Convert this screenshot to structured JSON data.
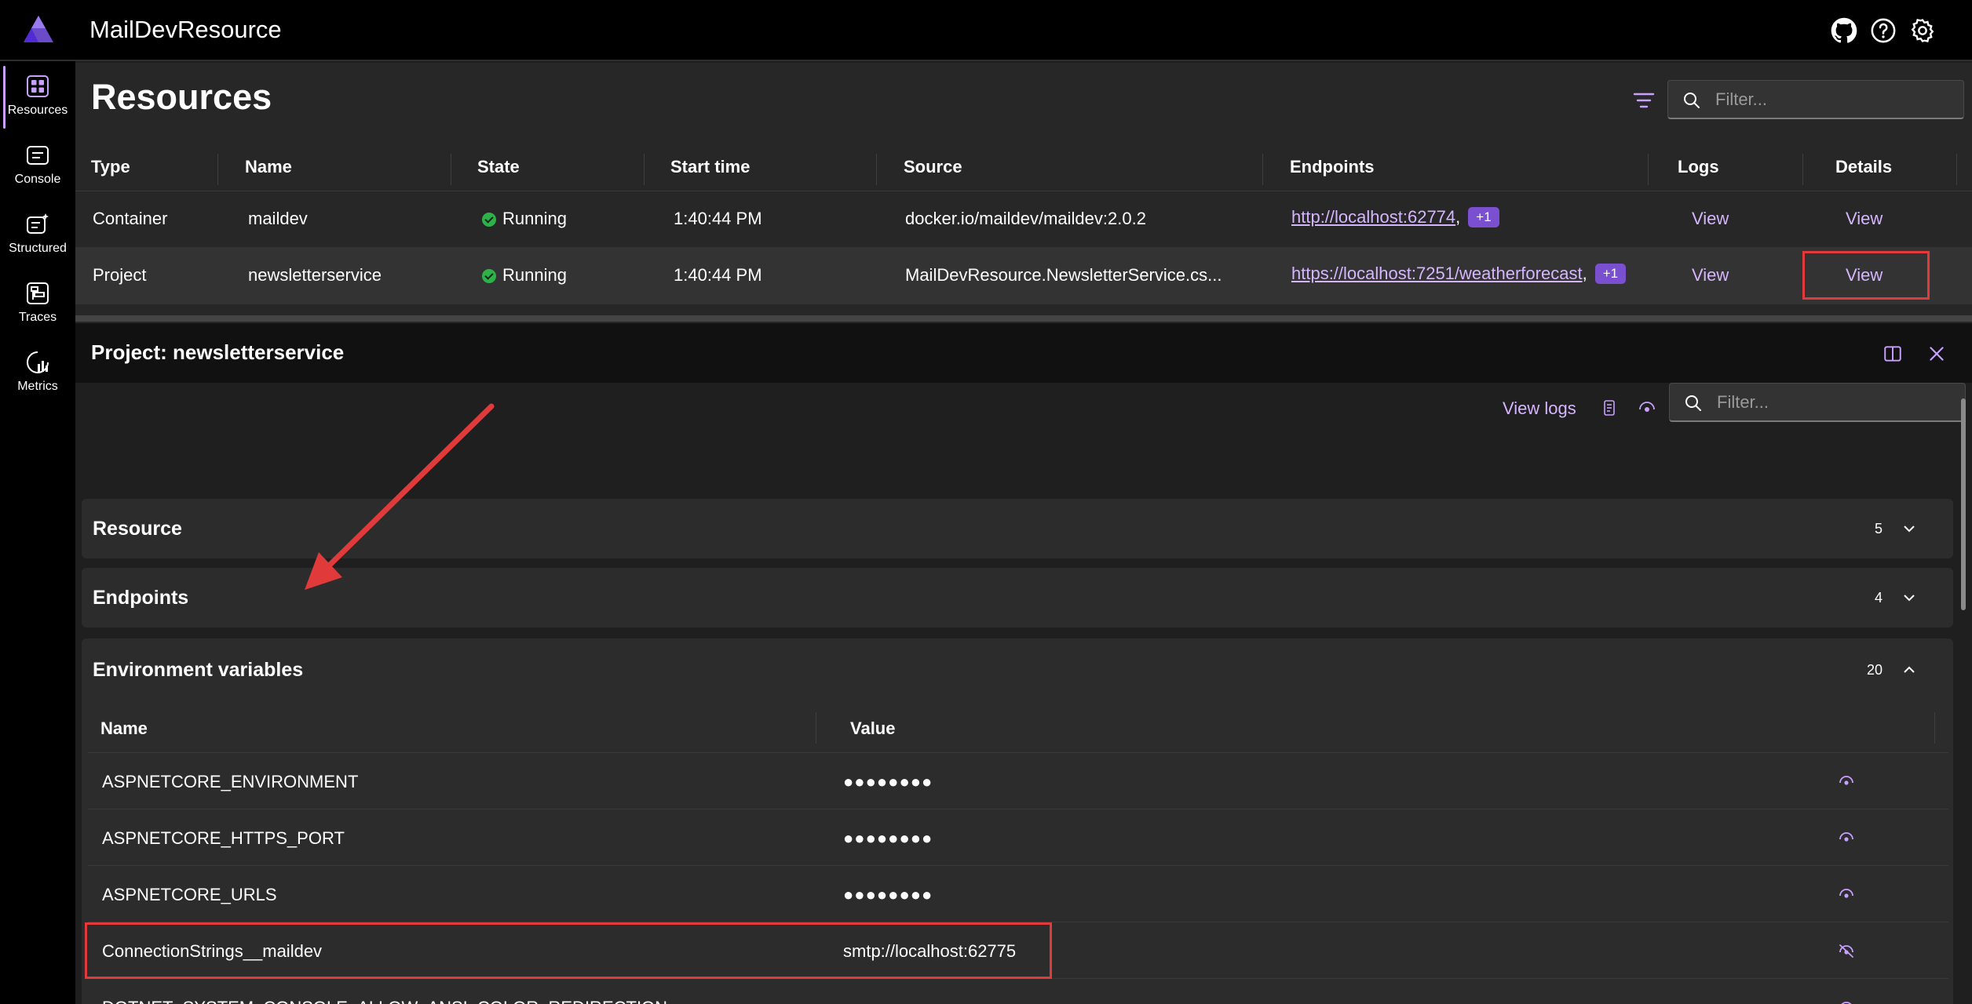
{
  "app": {
    "title": "MailDevResource"
  },
  "colors": {
    "accent": "#d6b5ff",
    "badge": "#7a4fd0",
    "running": "#2fb14a",
    "highlight": "#e03a3a"
  },
  "nav": [
    {
      "label": "Resources",
      "icon": "grid-icon",
      "active": true
    },
    {
      "label": "Console",
      "icon": "console-icon",
      "active": false
    },
    {
      "label": "Structured",
      "icon": "structured-logs-icon",
      "active": false
    },
    {
      "label": "Traces",
      "icon": "traces-icon",
      "active": false
    },
    {
      "label": "Metrics",
      "icon": "metrics-icon",
      "active": false
    }
  ],
  "resources": {
    "title": "Resources",
    "filter_placeholder": "Filter...",
    "columns": [
      "Type",
      "Name",
      "State",
      "Start time",
      "Source",
      "Endpoints",
      "Logs",
      "Details"
    ],
    "rows": [
      {
        "type": "Container",
        "name": "maildev",
        "state": "Running",
        "start_time": "1:40:44 PM",
        "source": "docker.io/maildev/maildev:2.0.2",
        "endpoint": "http://localhost:62774",
        "endpoint_sep": ",",
        "endpoint_more": "+1",
        "logs": "View",
        "details": "View"
      },
      {
        "type": "Project",
        "name": "newsletterservice",
        "state": "Running",
        "start_time": "1:40:44 PM",
        "source": "MailDevResource.NewsletterService.cs...",
        "endpoint": "https://localhost:7251/weatherforecast",
        "endpoint_sep": ",",
        "endpoint_more": "+1",
        "logs": "View",
        "details": "View"
      }
    ]
  },
  "details": {
    "title": "Project: newsletterservice",
    "view_logs": "View logs",
    "filter_placeholder": "Filter...",
    "sections": [
      {
        "title": "Resource",
        "count": "5",
        "expanded": false
      },
      {
        "title": "Endpoints",
        "count": "4",
        "expanded": false
      },
      {
        "title": "Environment variables",
        "count": "20",
        "expanded": true
      }
    ],
    "env_columns": [
      "Name",
      "Value"
    ],
    "env_vars": [
      {
        "name": "ASPNETCORE_ENVIRONMENT",
        "value": "●●●●●●●●",
        "masked": true
      },
      {
        "name": "ASPNETCORE_HTTPS_PORT",
        "value": "●●●●●●●●",
        "masked": true
      },
      {
        "name": "ASPNETCORE_URLS",
        "value": "●●●●●●●●",
        "masked": true
      },
      {
        "name": "ConnectionStrings__maildev",
        "value": "smtp://localhost:62775",
        "masked": false
      },
      {
        "name": "DOTNET_SYSTEM_CONSOLE_ALLOW_ANSI_COLOR_REDIRECTION",
        "value": "●●●●●●●●",
        "masked": true
      }
    ]
  }
}
